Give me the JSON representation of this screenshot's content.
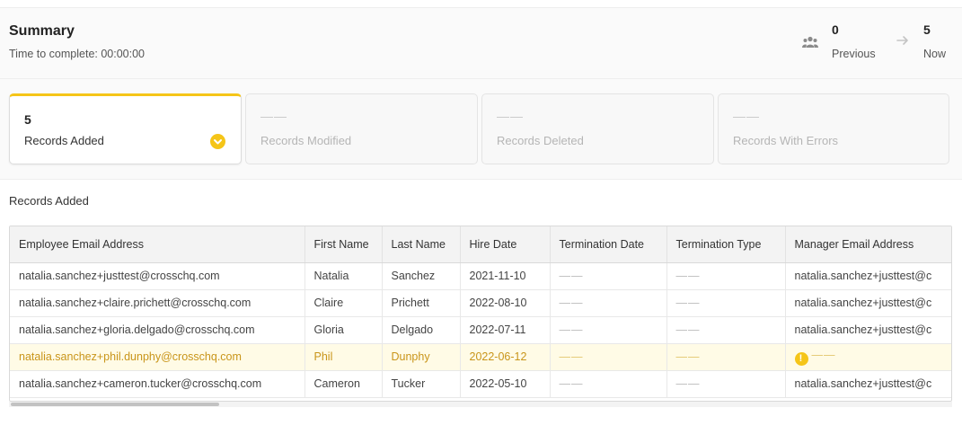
{
  "summary": {
    "title": "Summary",
    "time_label": "Time to complete: 00:00:00",
    "previous_value": "0",
    "previous_label": "Previous",
    "now_value": "5",
    "now_label": "Now",
    "people_icon": "people-icon",
    "arrow_icon": "arrow-right-icon"
  },
  "cards": [
    {
      "value": "5",
      "label": "Records Added",
      "active": true,
      "icon": "check-circle-icon"
    },
    {
      "value": "——",
      "label": "Records Modified",
      "active": false
    },
    {
      "value": "——",
      "label": "Records Deleted",
      "active": false
    },
    {
      "value": "——",
      "label": "Records With Errors",
      "active": false
    }
  ],
  "section_title": "Records Added",
  "table": {
    "headers": [
      "Employee Email Address",
      "First Name",
      "Last Name",
      "Hire Date",
      "Termination Date",
      "Termination Type",
      "Manager Email Address"
    ],
    "rows": [
      [
        "natalia.sanchez+justtest@crosschq.com",
        "Natalia",
        "Sanchez",
        "2021-11-10",
        "——",
        "——",
        "natalia.sanchez+justtest@c"
      ],
      [
        "natalia.sanchez+claire.prichett@crosschq.com",
        "Claire",
        "Prichett",
        "2022-08-10",
        "——",
        "——",
        "natalia.sanchez+justtest@c"
      ],
      [
        "natalia.sanchez+gloria.delgado@crosschq.com",
        "Gloria",
        "Delgado",
        "2022-07-11",
        "——",
        "——",
        "natalia.sanchez+justtest@c"
      ],
      [
        "natalia.sanchez+phil.dunphy@crosschq.com",
        "Phil",
        "Dunphy",
        "2022-06-12",
        "——",
        "——",
        "——"
      ],
      [
        "natalia.sanchez+cameron.tucker@crosschq.com",
        "Cameron",
        "Tucker",
        "2022-05-10",
        "——",
        "——",
        "natalia.sanchez+justtest@c"
      ]
    ],
    "warning_row_icon": "warning-icon"
  },
  "colors": {
    "accent": "#f5c518",
    "warning_text": "#c9951a",
    "warning_bg": "#fffbe6"
  }
}
